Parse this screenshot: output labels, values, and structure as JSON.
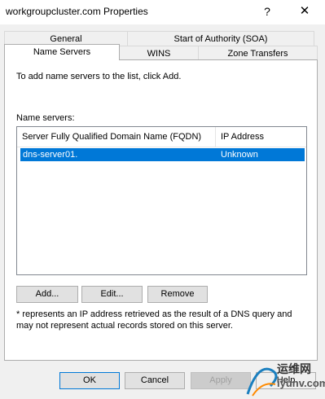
{
  "window": {
    "title": "workgroupcluster.com Properties",
    "help_glyph": "?",
    "close_glyph": "✕"
  },
  "tabs": {
    "row_back": [
      {
        "label": "General"
      },
      {
        "label": "Start of Authority (SOA)"
      }
    ],
    "row_front": [
      {
        "label": "Name Servers",
        "selected": true
      },
      {
        "label": "WINS"
      },
      {
        "label": "Zone Transfers"
      }
    ]
  },
  "panel": {
    "instruction": "To add name servers to the list, click Add.",
    "list_label": "Name servers:",
    "columns": [
      "Server Fully Qualified Domain Name (FQDN)",
      "IP Address"
    ],
    "rows": [
      {
        "fqdn": "dns-server01.",
        "ip": "Unknown",
        "selected": true
      }
    ],
    "actions": {
      "add": "Add...",
      "edit": "Edit...",
      "remove": "Remove"
    },
    "footnote_line1": "* represents an IP address retrieved as the result of a DNS query and",
    "footnote_line2": "may not represent actual records stored on this server."
  },
  "dialog_buttons": {
    "ok": "OK",
    "cancel": "Cancel",
    "apply": "Apply",
    "help": "Help"
  },
  "watermark": {
    "line1": "运维网",
    "line2": "iyunv.com"
  },
  "colors": {
    "selection": "#0078d7",
    "button_face": "#e1e1e1",
    "dialog_bg": "#f0f0f0"
  }
}
